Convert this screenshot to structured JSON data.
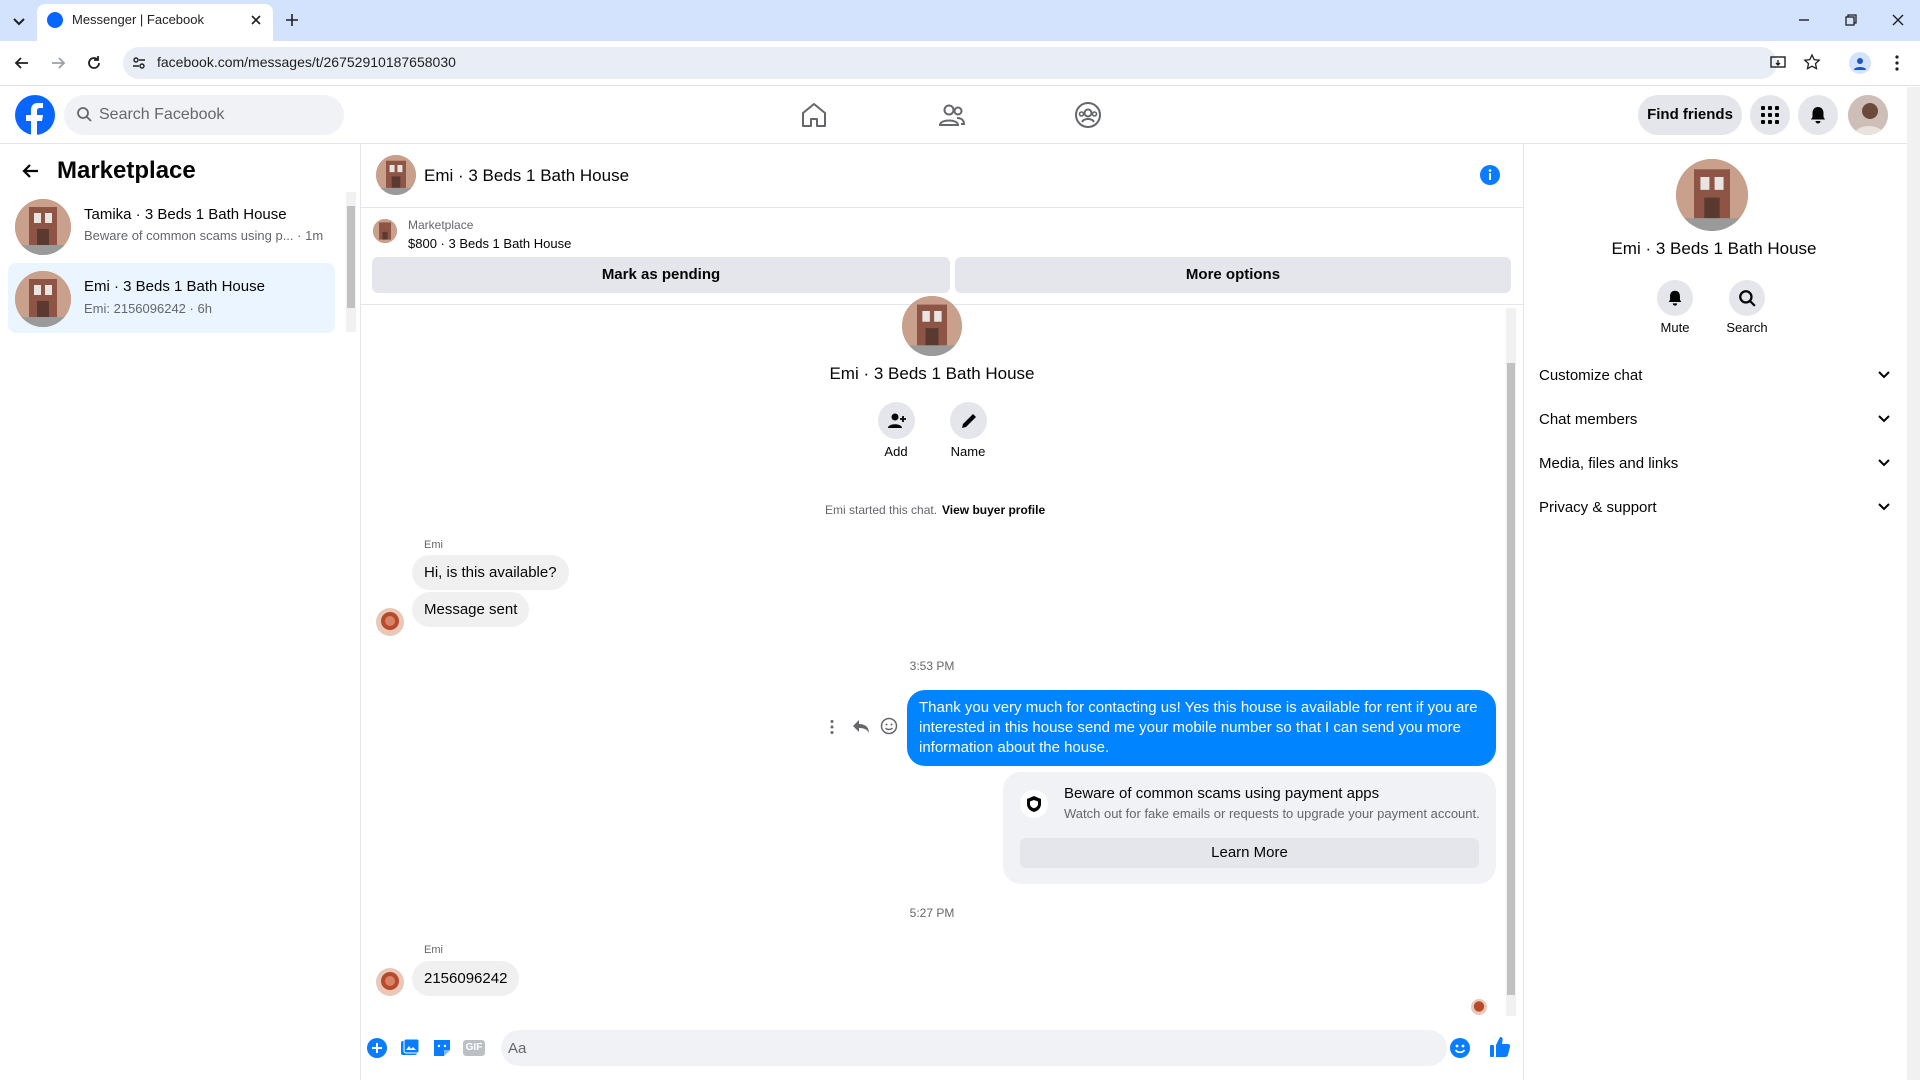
{
  "browser": {
    "tab_title": "Messenger | Facebook",
    "url": "facebook.com/messages/t/26752910187658030"
  },
  "header": {
    "search_placeholder": "Search Facebook",
    "find_friends": "Find friends"
  },
  "sidebar": {
    "title": "Marketplace",
    "conversations": [
      {
        "name": "Tamika · 3 Beds 1 Bath House",
        "preview": "Beware of common scams using p... · 1m"
      },
      {
        "name": "Emi · 3 Beds 1 Bath House",
        "preview": "Emi: 2156096242 · 6h"
      }
    ]
  },
  "chat": {
    "title": "Emi · 3 Beds 1 Bath House",
    "listing": {
      "category": "Marketplace",
      "summary": "$800 · 3 Beds 1 Bath House",
      "mark_pending": "Mark as pending",
      "more_options": "More options"
    },
    "intro": {
      "name": "Emi · 3 Beds 1 Bath House",
      "add_label": "Add",
      "name_label": "Name",
      "started_text": "Emi started this chat.",
      "view_profile": "View buyer profile"
    },
    "messages": {
      "sender1": "Emi",
      "msg1": "Hi, is this available?",
      "msg2": "Message sent",
      "time1": "3:53 PM",
      "outgoing": "Thank you very much for contacting us! Yes this house is available for rent if you are interested in this house send me your mobile number so that I can send you more information about the house.",
      "scam_title": "Beware of common scams using payment apps",
      "scam_body": "Watch out for fake emails or requests to upgrade your payment account.",
      "learn_more": "Learn More",
      "time2": "5:27 PM",
      "sender2": "Emi",
      "msg3": "2156096242"
    },
    "composer_placeholder": "Aa"
  },
  "details": {
    "name": "Emi · 3 Beds 1 Bath House",
    "mute": "Mute",
    "search": "Search",
    "sections": [
      "Customize chat",
      "Chat members",
      "Media, files and links",
      "Privacy & support"
    ]
  },
  "colors": {
    "fb_blue": "#0866ff",
    "bubble_out": "#0084ff",
    "messenger_blue": "#0a7cff"
  }
}
